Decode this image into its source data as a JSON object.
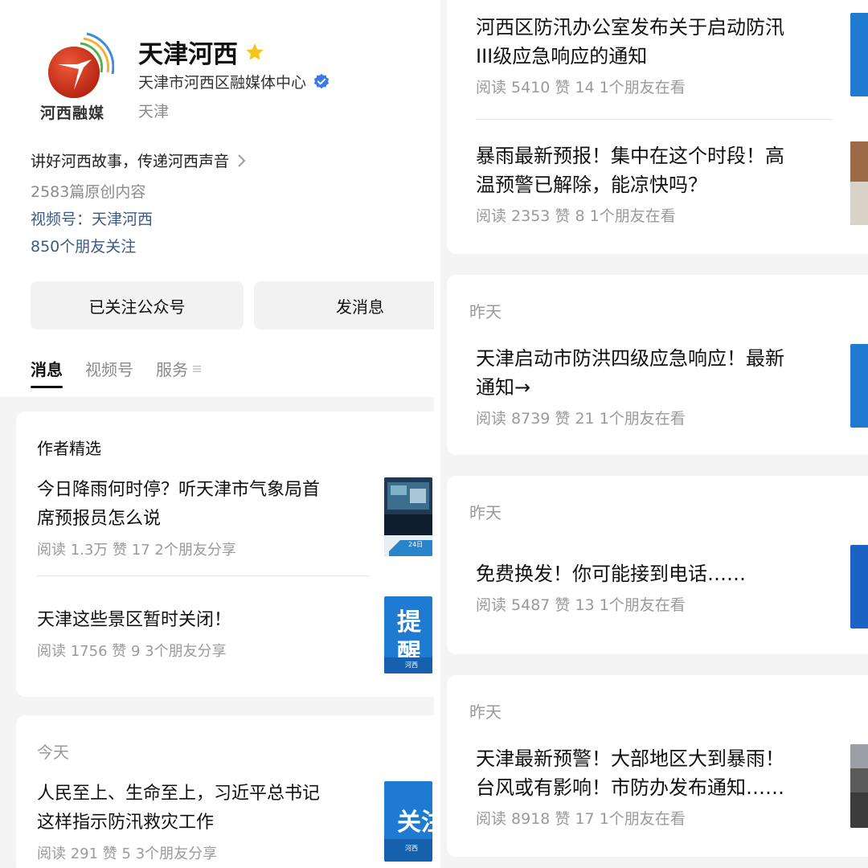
{
  "profile": {
    "logo_text": "河西融媒",
    "name": "天津河西",
    "org": "天津市河西区融媒体中心",
    "location": "天津",
    "slogan": "讲好河西故事，传递河西声音",
    "original_count": "2583篇原创内容",
    "video_channel": "视频号：天津河西",
    "friends_follow": "850个朋友关注",
    "follow_button": "已关注公众号",
    "message_button": "发消息",
    "star_color": "#f5c518",
    "verified_color": "#3d7ae6",
    "link_color": "#3b5a85"
  },
  "tabs": [
    {
      "label": "消息",
      "active": true
    },
    {
      "label": "视频号",
      "active": false
    },
    {
      "label": "服务",
      "active": false,
      "icon": "menu-icon"
    }
  ],
  "featured": {
    "section_title": "作者精选",
    "articles": [
      {
        "title_line1": "今日降雨何时停？听天津市气象局首",
        "title_line2": "席预报员怎么说",
        "meta": "阅读 1.3万  赞 17  2个朋友分享",
        "thumb_text": "24日"
      },
      {
        "title_line1": "天津这些景区暂时关闭！",
        "meta": "阅读 1756  赞 9  3个朋友分享",
        "thumb_text": "提醒",
        "thumb_brand": "河西"
      }
    ]
  },
  "today": {
    "day_label": "今天",
    "article": {
      "title_line1": "人民至上、生命至上，习近平总书记",
      "title_line2": "这样指示防汛救灾工作",
      "meta": "阅读 291  赞 5  3个朋友分享",
      "thumb_text": "关注",
      "thumb_brand": "河西"
    }
  },
  "right_feed": {
    "top_articles": [
      {
        "title_line1": "河西区防汛办公室发布关于启动防汛",
        "title_line2": "III级应急响应的通知",
        "meta": "阅读 5410  赞 14  1个朋友在看"
      },
      {
        "title_line1": "暴雨最新预报！集中在这个时段！高",
        "title_line2": "温预警已解除，能凉快吗？",
        "meta": "阅读 2353  赞 8  1个朋友在看"
      }
    ],
    "groups": [
      {
        "day_label": "昨天",
        "title_line1": "天津启动市防洪四级应急响应！最新",
        "title_line2": "通知→",
        "meta": "阅读 8739  赞 21  1个朋友在看"
      },
      {
        "day_label": "昨天",
        "title_line1": "免费换发！你可能接到电话……",
        "meta": "阅读 5487  赞 13  1个朋友在看"
      },
      {
        "day_label": "昨天",
        "title_line1": "天津最新预警！大部地区大到暴雨！",
        "title_line2": "台风或有影响！市防办发布通知……",
        "meta": "阅读 8918  赞 17  1个朋友在看"
      }
    ]
  }
}
